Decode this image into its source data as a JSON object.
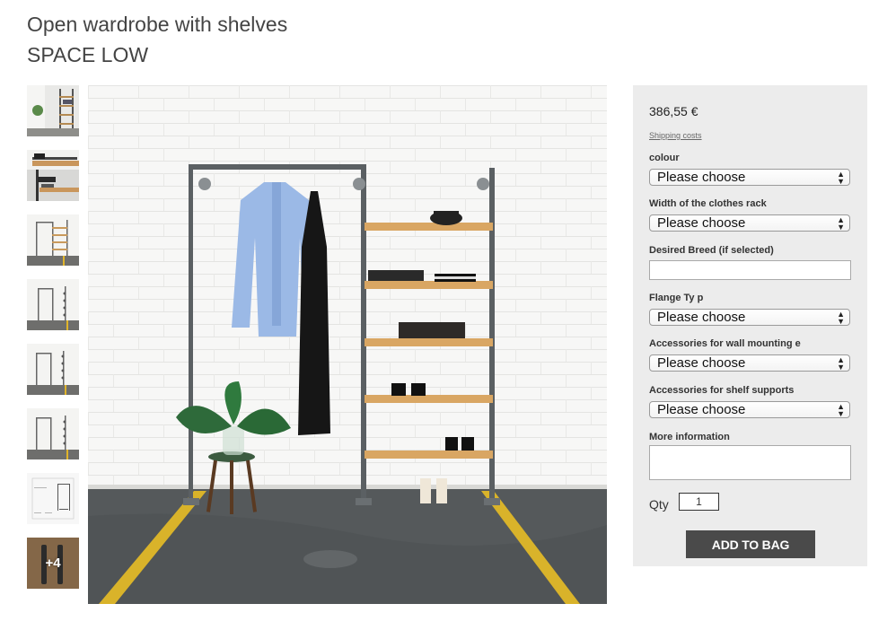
{
  "product": {
    "title": "Open wardrobe with shelves",
    "subtitle": "SPACE LOW"
  },
  "gallery": {
    "thumbnail_count": 8,
    "more_label": "+4"
  },
  "purchase": {
    "price": "386,55 €",
    "shipping_link": "Shipping costs",
    "fields": [
      {
        "label": "colour",
        "type": "select",
        "value": "Please choose"
      },
      {
        "label": "Width of the clothes rack",
        "type": "select",
        "value": "Please choose"
      },
      {
        "label": "Desired Breed (if selected)",
        "type": "text",
        "value": ""
      },
      {
        "label": "Flange Ty p",
        "type": "select",
        "value": "Please choose"
      },
      {
        "label": "Accessories for wall mounting e",
        "type": "select",
        "value": "Please choose"
      },
      {
        "label": "Accessories for shelf supports",
        "type": "select",
        "value": "Please choose"
      },
      {
        "label": "More information",
        "type": "textarea",
        "value": ""
      }
    ],
    "qty_label": "Qty",
    "qty_value": "1",
    "add_to_bag": "ADD TO BAG"
  },
  "icons": {
    "select_arrows": "updown-arrows-icon"
  },
  "colors": {
    "panel_bg": "#ececec",
    "button_bg": "#4a4a4a",
    "button_text": "#ffffff",
    "floor_stripe": "#e0b42a"
  }
}
